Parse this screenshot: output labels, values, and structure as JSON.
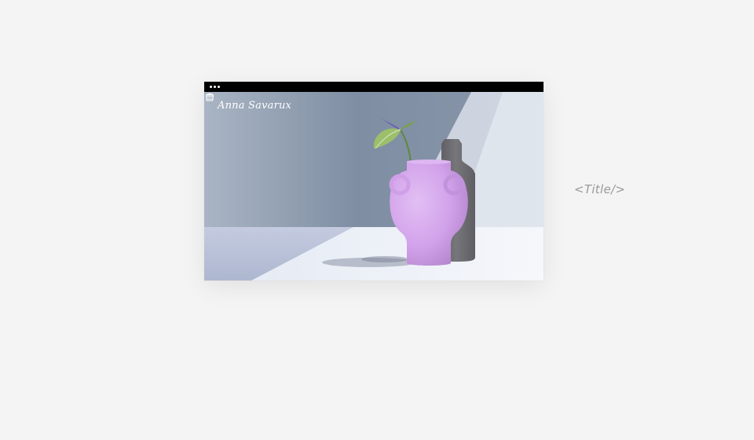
{
  "site": {
    "title": "Anna Savarux"
  },
  "header_icons": [
    "shopping-bag-icon",
    "hamburger-menu-icon"
  ],
  "placeholder": {
    "label": "<Title/>"
  },
  "colors": {
    "page_background": "#f4f4f4",
    "browser_bar": "#000000",
    "vase_lilac": "#d5a6ec",
    "bottle_grey": "#6d6c70",
    "placeholder_text": "#9a9a9a"
  }
}
